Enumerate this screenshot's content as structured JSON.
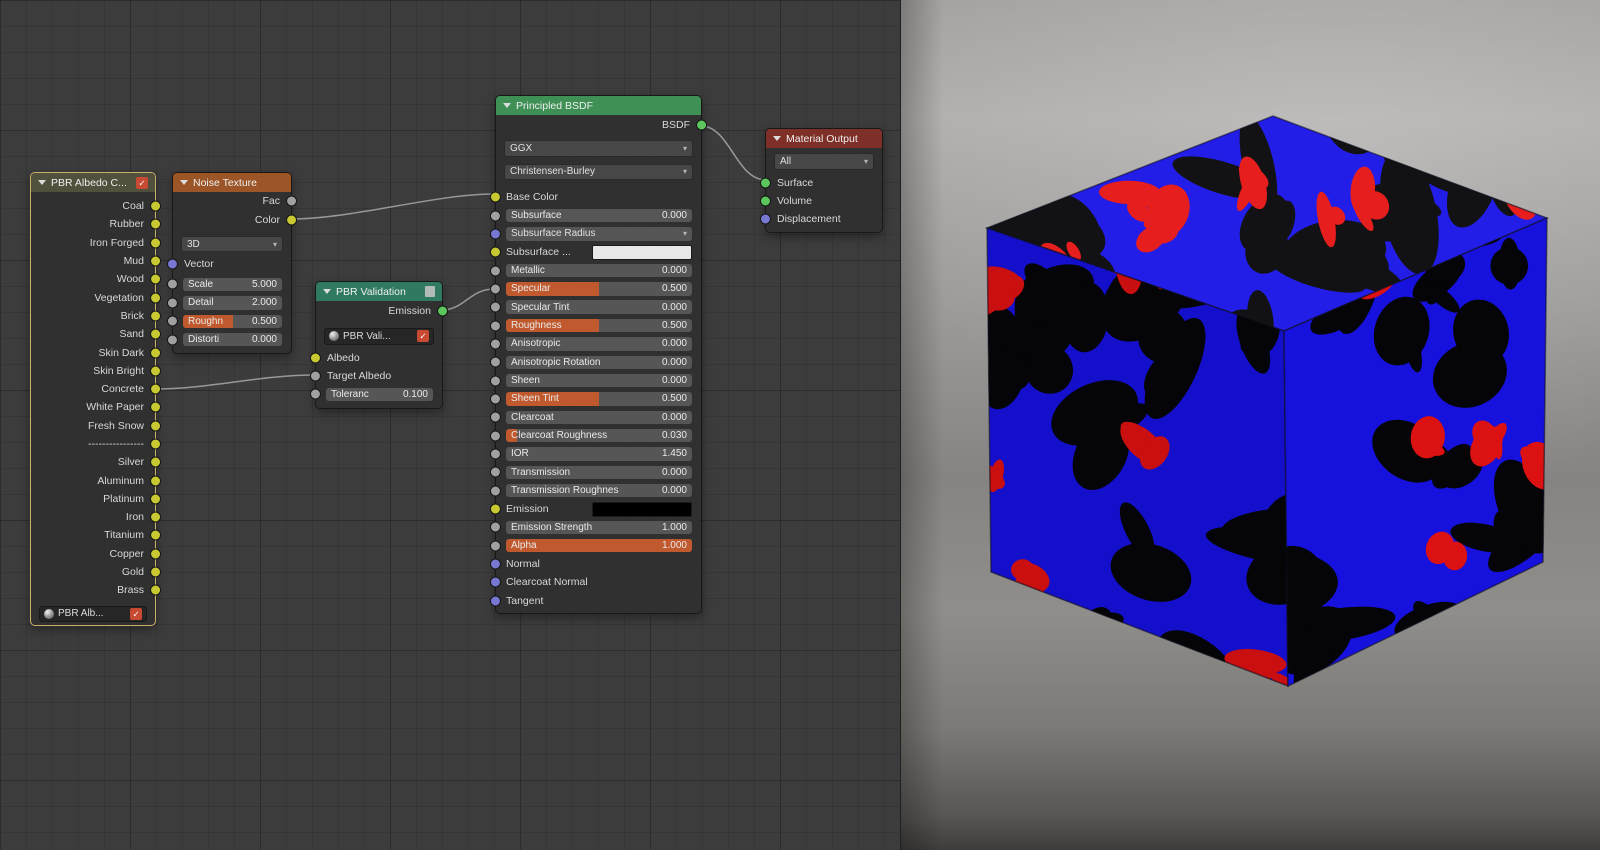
{
  "nodes": {
    "albedo": {
      "title": "PBR Albedo C...",
      "outputs": [
        "Coal",
        "Rubber",
        "Iron Forged",
        "Mud",
        "Wood",
        "Vegetation",
        "Brick",
        "Sand",
        "Skin Dark",
        "Skin Bright",
        "Concrete",
        "White Paper",
        "Fresh Snow",
        "----------------",
        "Silver",
        "Aluminum",
        "Platinum",
        "Iron",
        "Titanium",
        "Copper",
        "Gold",
        "Brass"
      ],
      "selector": "PBR Alb..."
    },
    "noise": {
      "title": "Noise Texture",
      "outputs": [
        {
          "label": "Fac",
          "socket": "gray"
        },
        {
          "label": "Color",
          "socket": "yellow"
        }
      ],
      "dimensions": "3D",
      "vector_label": "Vector",
      "params": [
        {
          "label": "Scale",
          "value": "5.000",
          "fill": 0
        },
        {
          "label": "Detail",
          "value": "2.000",
          "fill": 0
        },
        {
          "label": "Roughn",
          "value": "0.500",
          "fill": 0.5
        },
        {
          "label": "Distorti",
          "value": "0.000",
          "fill": 0
        }
      ]
    },
    "validation": {
      "title": "PBR Validation",
      "output": "Emission",
      "selector": "PBR Vali...",
      "inputs": [
        {
          "label": "Albedo",
          "socket": "yellow"
        },
        {
          "label": "Target Albedo",
          "socket": "gray"
        }
      ],
      "param": {
        "label": "Toleranc",
        "value": "0.100"
      }
    },
    "principled": {
      "title": "Principled BSDF",
      "output": "BSDF",
      "distribution": "GGX",
      "sss_method": "Christensen-Burley",
      "rows": [
        {
          "label": "Base Color",
          "type": "input",
          "socket": "yellow"
        },
        {
          "label": "Subsurface",
          "type": "slider",
          "socket": "gray",
          "value": "0.000",
          "fill": 0
        },
        {
          "label": "Subsurface Radius",
          "type": "vector",
          "socket": "purple"
        },
        {
          "label": "Subsurface ...",
          "type": "color",
          "socket": "yellow",
          "color": "#e8e8e8"
        },
        {
          "label": "Metallic",
          "type": "slider",
          "socket": "gray",
          "value": "0.000",
          "fill": 0
        },
        {
          "label": "Specular",
          "type": "slider",
          "socket": "gray",
          "value": "0.500",
          "fill": 0.5
        },
        {
          "label": "Specular Tint",
          "type": "slider",
          "socket": "gray",
          "value": "0.000",
          "fill": 0
        },
        {
          "label": "Roughness",
          "type": "slider",
          "socket": "gray",
          "value": "0.500",
          "fill": 0.5
        },
        {
          "label": "Anisotropic",
          "type": "slider",
          "socket": "gray",
          "value": "0.000",
          "fill": 0
        },
        {
          "label": "Anisotropic Rotation",
          "type": "slider",
          "socket": "gray",
          "value": "0.000",
          "fill": 0
        },
        {
          "label": "Sheen",
          "type": "slider",
          "socket": "gray",
          "value": "0.000",
          "fill": 0
        },
        {
          "label": "Sheen Tint",
          "type": "slider",
          "socket": "gray",
          "value": "0.500",
          "fill": 0.5
        },
        {
          "label": "Clearcoat",
          "type": "slider",
          "socket": "gray",
          "value": "0.000",
          "fill": 0
        },
        {
          "label": "Clearcoat Roughness",
          "type": "slider",
          "socket": "gray",
          "value": "0.030",
          "fill": 0.06
        },
        {
          "label": "IOR",
          "type": "slider",
          "socket": "gray",
          "value": "1.450",
          "fill": 0
        },
        {
          "label": "Transmission",
          "type": "slider",
          "socket": "gray",
          "value": "0.000",
          "fill": 0
        },
        {
          "label": "Transmission Roughnes",
          "type": "slider",
          "socket": "gray",
          "value": "0.000",
          "fill": 0
        },
        {
          "label": "Emission",
          "type": "color",
          "socket": "yellow",
          "color": "#000000"
        },
        {
          "label": "Emission Strength",
          "type": "slider",
          "socket": "gray",
          "value": "1.000",
          "fill": 0
        },
        {
          "label": "Alpha",
          "type": "slider",
          "socket": "gray",
          "value": "1.000",
          "fill": 1
        },
        {
          "label": "Normal",
          "type": "input",
          "socket": "purple"
        },
        {
          "label": "Clearcoat Normal",
          "type": "input",
          "socket": "purple"
        },
        {
          "label": "Tangent",
          "type": "input",
          "socket": "purple"
        }
      ]
    },
    "output": {
      "title": "Material Output",
      "target": "All",
      "inputs": [
        {
          "label": "Surface",
          "socket": "green"
        },
        {
          "label": "Volume",
          "socket": "green"
        },
        {
          "label": "Displacement",
          "socket": "purple"
        }
      ]
    }
  },
  "viewport": {
    "texture": {
      "blue": "#1712e6",
      "red": "#e51212",
      "black": "#060608"
    }
  }
}
